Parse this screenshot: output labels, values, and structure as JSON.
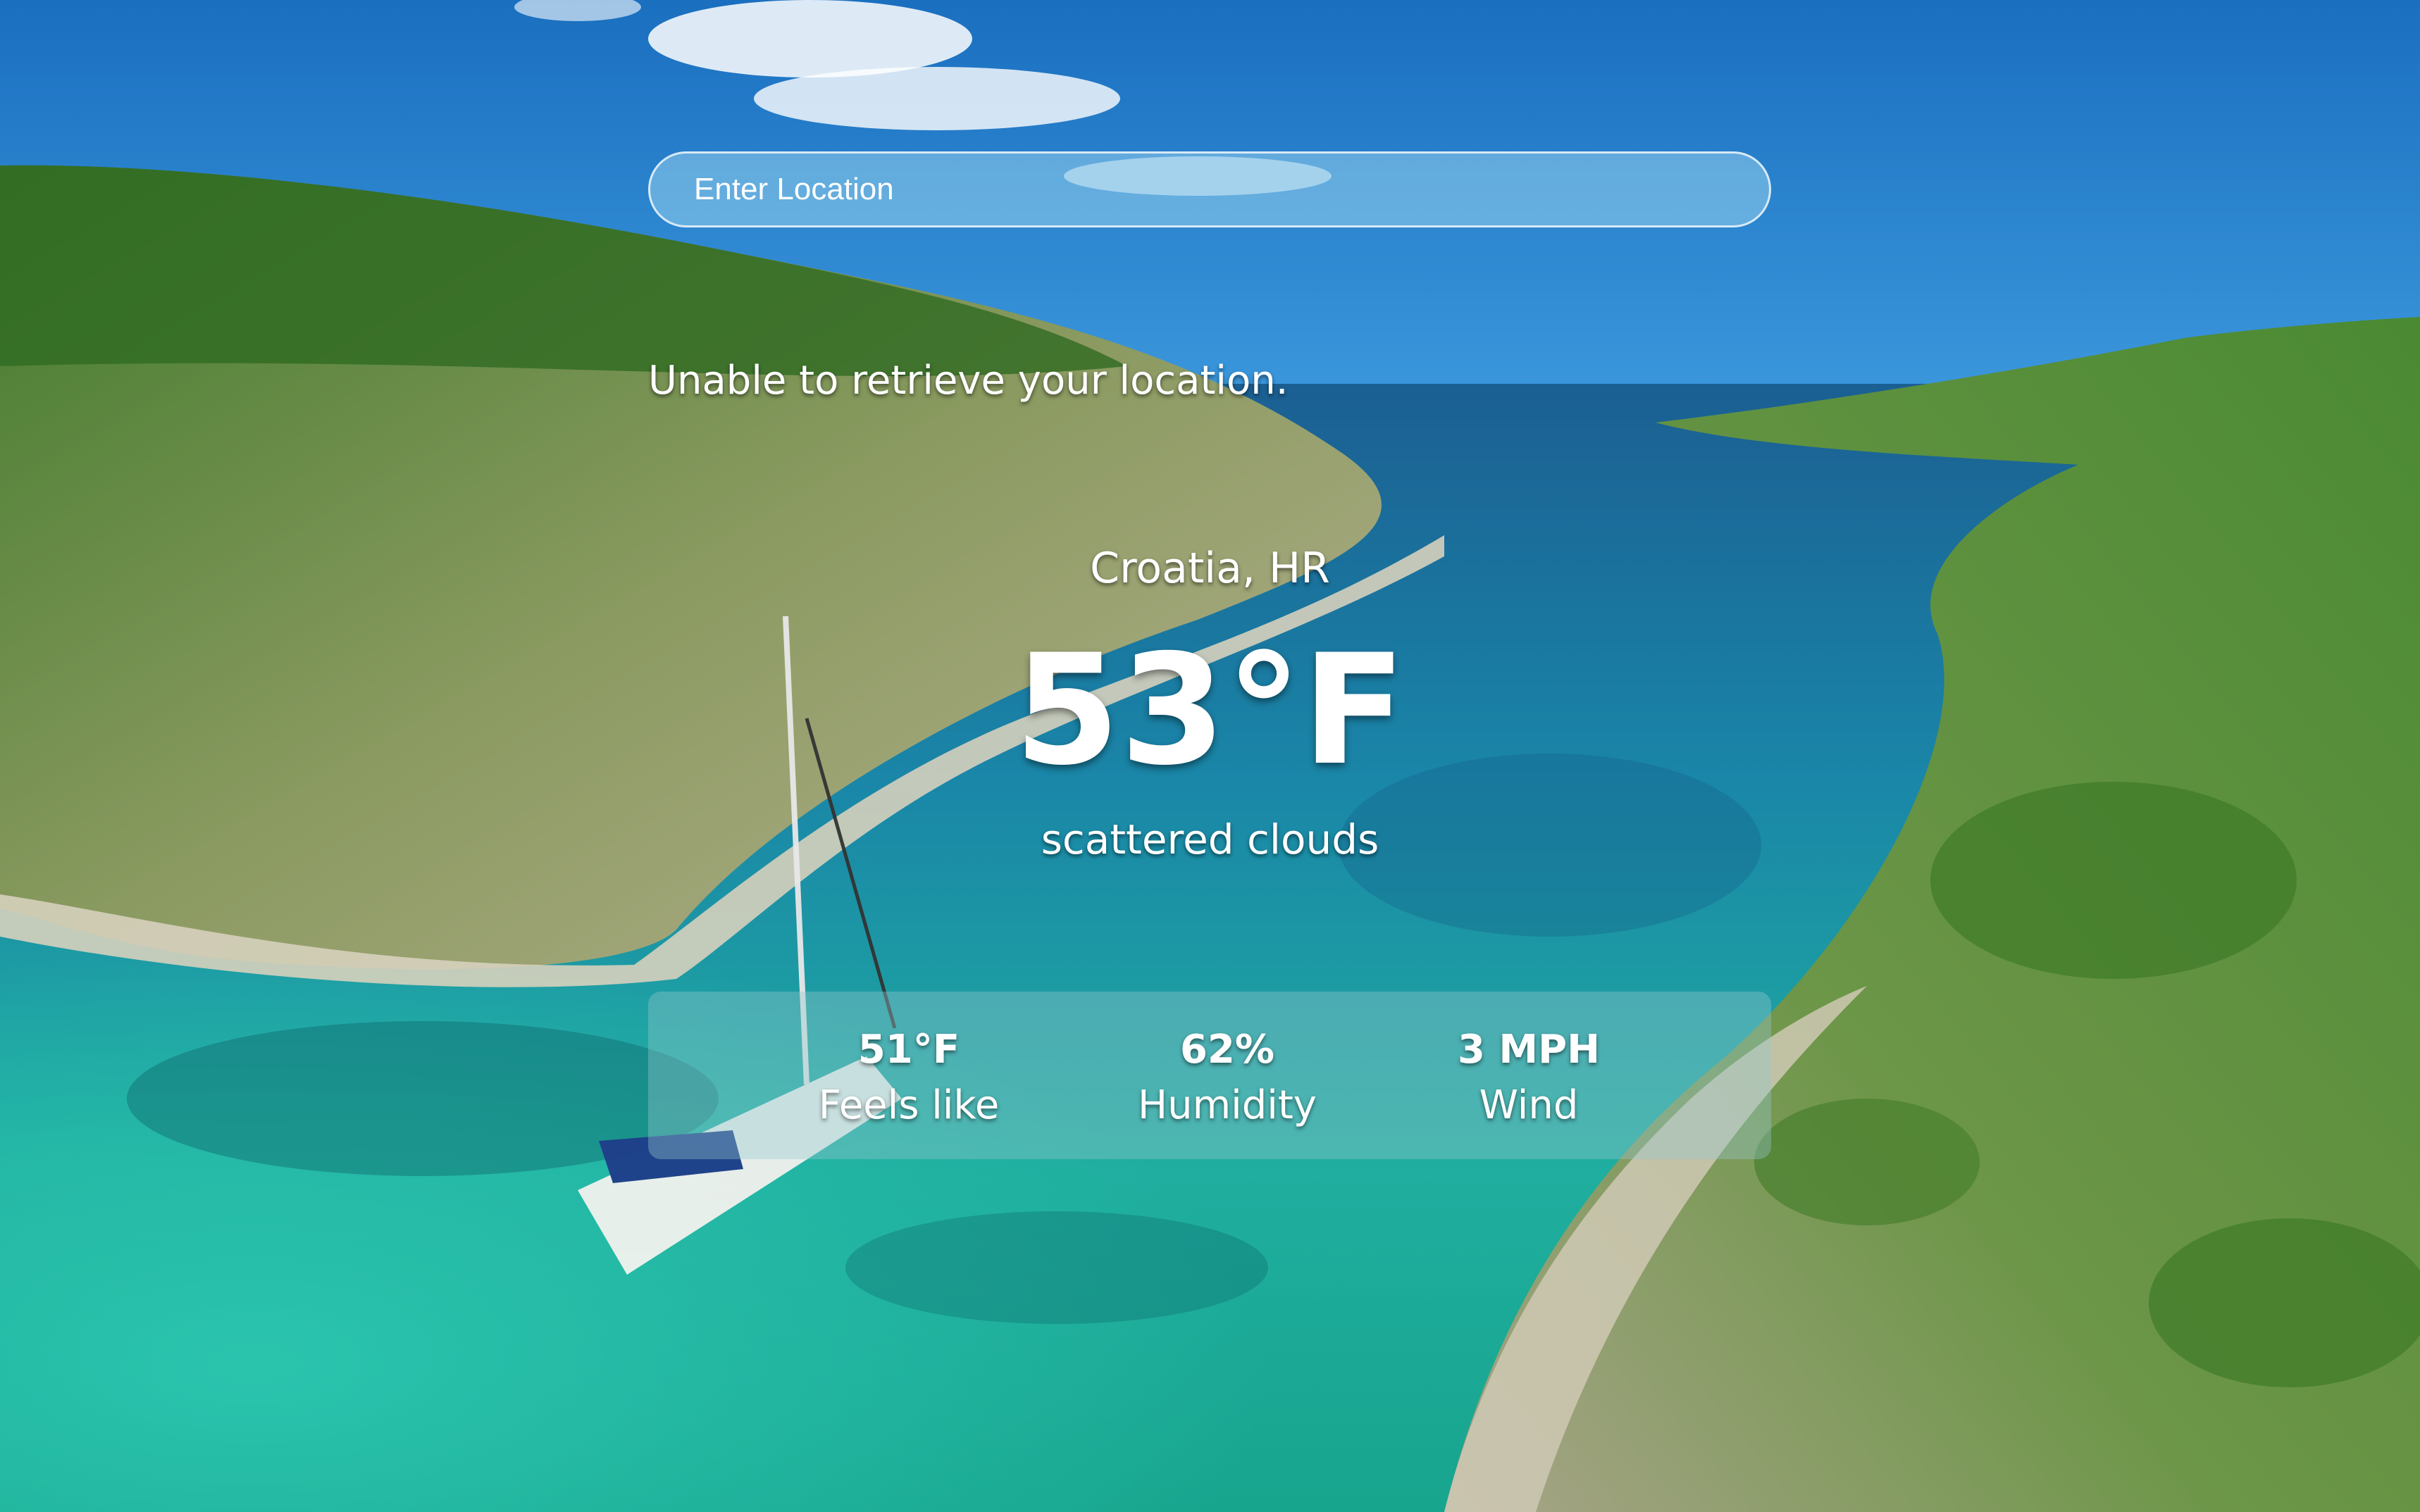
{
  "search": {
    "placeholder": "Enter Location"
  },
  "status_message": "Unable to retrieve your location.",
  "weather": {
    "location": "Croatia, HR",
    "temperature": "53°F",
    "description": "scattered clouds",
    "stats": [
      {
        "value": "51°F",
        "label": "Feels like"
      },
      {
        "value": "62%",
        "label": "Humidity"
      },
      {
        "value": "3 MPH",
        "label": "Wind"
      }
    ]
  },
  "background": {
    "subject": "aerial view of a turquoise Croatian bay with a sailboat between green rocky hills",
    "colors": {
      "sky": "#1f7ccc",
      "sea_deep": "#1a6f9a",
      "sea_shallow": "#22b9a8",
      "hills": "#5a8a35",
      "rock": "#c9c2a8"
    }
  },
  "colors": {
    "text": "#ffffff",
    "search_border": "#ffffff",
    "panel_tint": "#96c8cd"
  }
}
